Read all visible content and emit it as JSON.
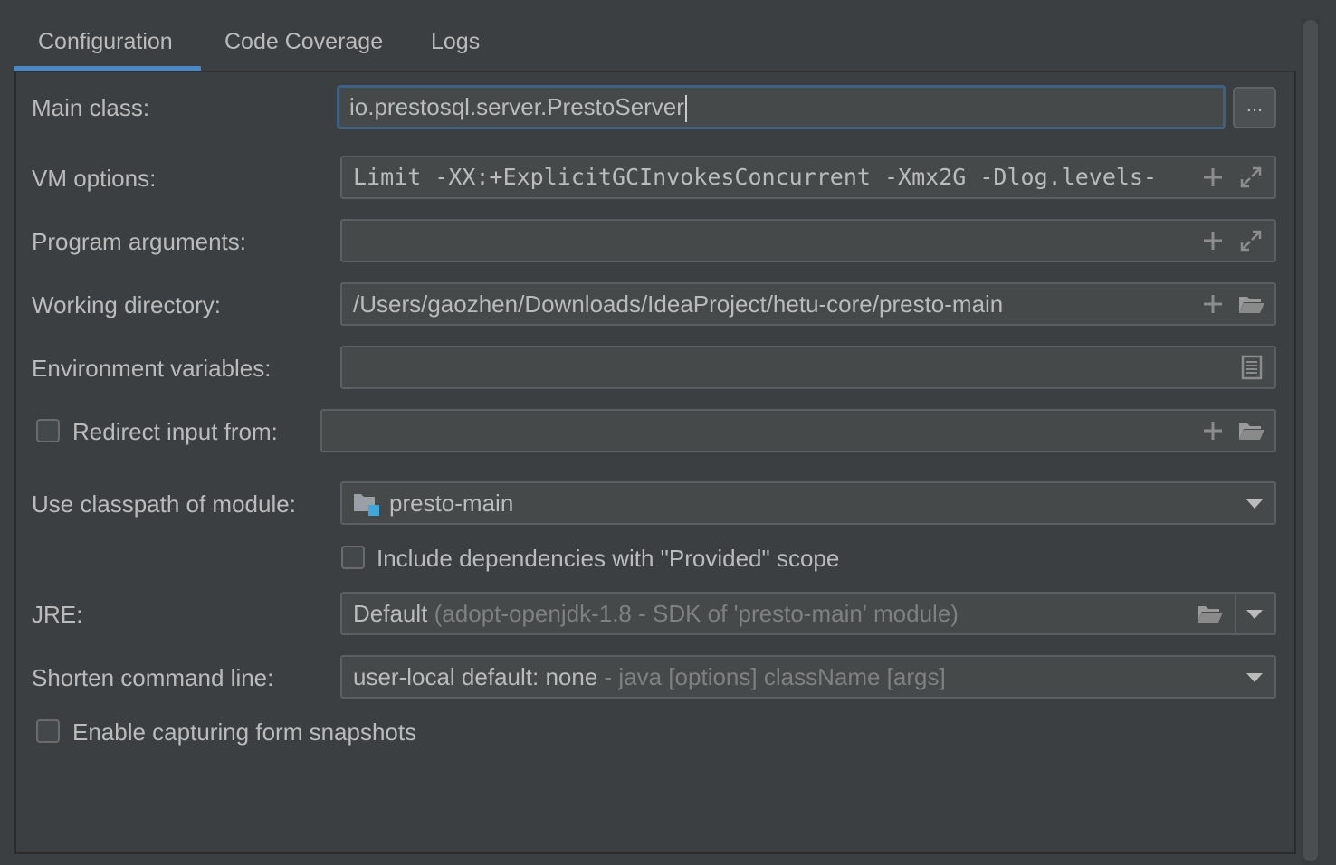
{
  "tabs": [
    {
      "label": "Configuration",
      "active": true
    },
    {
      "label": "Code Coverage",
      "active": false
    },
    {
      "label": "Logs",
      "active": false
    }
  ],
  "form": {
    "main_class": {
      "label": "Main class:",
      "value": "io.prestosql.server.PrestoServer",
      "browse_label": "..."
    },
    "vm_options": {
      "label": "VM options:",
      "value": "Limit -XX:+ExplicitGCInvokesConcurrent -Xmx2G -Dlog.levels-"
    },
    "program_arguments": {
      "label": "Program arguments:",
      "value": ""
    },
    "working_directory": {
      "label": "Working directory:",
      "value": "/Users/gaozhen/Downloads/IdeaProject/hetu-core/presto-main"
    },
    "environment_variables": {
      "label": "Environment variables:",
      "value": ""
    },
    "redirect_input": {
      "label": "Redirect input from:",
      "checked": false,
      "value": ""
    },
    "classpath_module": {
      "label": "Use classpath of module:",
      "value": "presto-main"
    },
    "include_provided": {
      "label": "Include dependencies with \"Provided\" scope",
      "checked": false
    },
    "jre": {
      "label": "JRE:",
      "value": "Default",
      "hint": "(adopt-openjdk-1.8 - SDK of 'presto-main' module)"
    },
    "shorten_command_line": {
      "label": "Shorten command line:",
      "value": "user-local default: none",
      "hint": "- java [options] className [args]"
    },
    "capture_snapshots": {
      "label": "Enable capturing form snapshots",
      "checked": false
    }
  },
  "icons": {
    "add": "plus-icon",
    "expand": "expand-icon",
    "folder": "folder-open-icon",
    "document": "document-icon",
    "module": "module-folder-icon",
    "dropdown": "chevron-down-icon"
  },
  "colors": {
    "background": "#3c3f41",
    "field_bg": "#45494a",
    "accent": "#4a88c7",
    "focus_border": "#3d6185",
    "text": "#bbbbbb",
    "hint": "#808080"
  }
}
